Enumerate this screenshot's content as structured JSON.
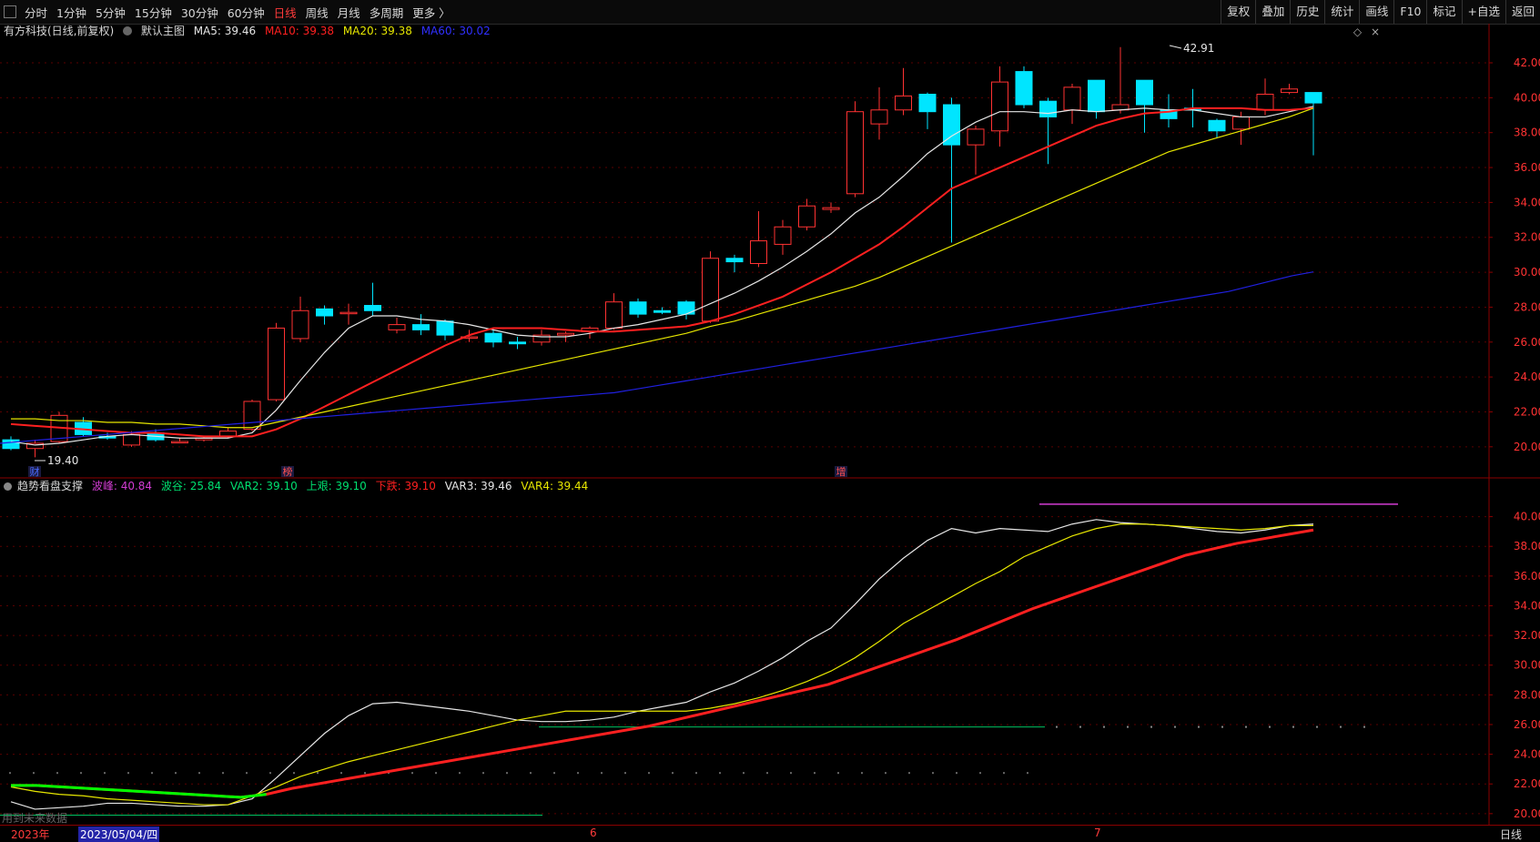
{
  "toolbar": {
    "periods": [
      "分时",
      "1分钟",
      "5分钟",
      "15分钟",
      "30分钟",
      "60分钟",
      "日线",
      "周线",
      "月线",
      "多周期",
      "更多 〉"
    ],
    "active_index": 6,
    "right": [
      "复权",
      "叠加",
      "历史",
      "统计",
      "画线",
      "F10",
      "标记",
      "+自选",
      "返回"
    ]
  },
  "main": {
    "title": "有方科技(日线,前复权)",
    "template": "默认主图",
    "ma5": "MA5: 39.46",
    "ma10": "MA10: 39.38",
    "ma20": "MA20: 39.38",
    "ma60": "MA60: 30.02",
    "high_label": "42.91",
    "low_label": "19.40",
    "marker1": "财",
    "marker2": "榜",
    "marker3": "增"
  },
  "sub": {
    "title": "趋势看盘支撑",
    "bofeng": "波峰: 40.84",
    "bogu": "波谷: 25.84",
    "var2": "VAR2: 39.10",
    "shangchuan": "上艰: 39.10",
    "xiadie": "下跌: 39.10",
    "var3": "VAR3: 39.46",
    "var4": "VAR4: 39.44",
    "note": "用到未来数据"
  },
  "dateaxis": {
    "year": "2023年",
    "cursor": "2023/05/04/四",
    "m6": "6",
    "m7": "7",
    "period": "日线"
  },
  "colors": {
    "up": "#ff3232",
    "down": "#00e5ff",
    "ma5": "#e6e6e6",
    "ma10": "#ff2020",
    "ma20": "#e6e600",
    "ma60": "#2020e0",
    "purple": "#d23cd2",
    "green": "#00ff00",
    "grid": "#5a0000"
  },
  "chart_data": [
    {
      "type": "candlestick",
      "title": "有方科技(日线,前复权)",
      "ylim": [
        19,
        43.2
      ],
      "yticks": [
        20,
        22,
        24,
        26,
        28,
        30,
        32,
        34,
        36,
        38,
        40,
        42
      ],
      "candles": [
        {
          "o": 20.4,
          "h": 20.6,
          "l": 19.8,
          "c": 19.9
        },
        {
          "o": 19.9,
          "h": 20.4,
          "l": 19.4,
          "c": 20.2
        },
        {
          "o": 20.3,
          "h": 22.0,
          "l": 20.2,
          "c": 21.8
        },
        {
          "o": 21.4,
          "h": 21.7,
          "l": 20.6,
          "c": 20.7
        },
        {
          "o": 20.6,
          "h": 20.8,
          "l": 20.4,
          "c": 20.5
        },
        {
          "o": 20.1,
          "h": 20.9,
          "l": 20.0,
          "c": 20.7
        },
        {
          "o": 20.8,
          "h": 21.0,
          "l": 20.3,
          "c": 20.4
        },
        {
          "o": 20.3,
          "h": 20.5,
          "l": 20.2,
          "c": 20.3
        },
        {
          "o": 20.4,
          "h": 20.6,
          "l": 20.3,
          "c": 20.5
        },
        {
          "o": 20.6,
          "h": 21.1,
          "l": 20.5,
          "c": 20.9
        },
        {
          "o": 21.0,
          "h": 22.7,
          "l": 20.9,
          "c": 22.6
        },
        {
          "o": 22.7,
          "h": 27.1,
          "l": 22.6,
          "c": 26.8
        },
        {
          "o": 26.2,
          "h": 28.6,
          "l": 26.0,
          "c": 27.8
        },
        {
          "o": 27.9,
          "h": 28.1,
          "l": 27.0,
          "c": 27.5
        },
        {
          "o": 27.7,
          "h": 28.2,
          "l": 27.0,
          "c": 27.7
        },
        {
          "o": 28.1,
          "h": 29.4,
          "l": 27.5,
          "c": 27.8
        },
        {
          "o": 26.7,
          "h": 27.4,
          "l": 26.5,
          "c": 27.0
        },
        {
          "o": 27.0,
          "h": 27.6,
          "l": 26.4,
          "c": 26.7
        },
        {
          "o": 27.2,
          "h": 27.3,
          "l": 26.1,
          "c": 26.4
        },
        {
          "o": 26.3,
          "h": 26.7,
          "l": 26.0,
          "c": 26.3
        },
        {
          "o": 26.5,
          "h": 26.7,
          "l": 25.7,
          "c": 26.0
        },
        {
          "o": 26.0,
          "h": 26.3,
          "l": 25.6,
          "c": 25.9
        },
        {
          "o": 26.0,
          "h": 26.7,
          "l": 25.8,
          "c": 26.4
        },
        {
          "o": 26.4,
          "h": 26.6,
          "l": 26.0,
          "c": 26.5
        },
        {
          "o": 26.6,
          "h": 26.9,
          "l": 26.2,
          "c": 26.8
        },
        {
          "o": 26.8,
          "h": 28.8,
          "l": 26.7,
          "c": 28.3
        },
        {
          "o": 28.3,
          "h": 28.5,
          "l": 27.4,
          "c": 27.6
        },
        {
          "o": 27.8,
          "h": 28.0,
          "l": 27.6,
          "c": 27.7
        },
        {
          "o": 28.3,
          "h": 28.4,
          "l": 27.3,
          "c": 27.6
        },
        {
          "o": 27.2,
          "h": 31.2,
          "l": 27.1,
          "c": 30.8
        },
        {
          "o": 30.8,
          "h": 31.0,
          "l": 30.0,
          "c": 30.6
        },
        {
          "o": 30.5,
          "h": 33.5,
          "l": 30.3,
          "c": 31.8
        },
        {
          "o": 31.6,
          "h": 33.0,
          "l": 31.0,
          "c": 32.6
        },
        {
          "o": 32.6,
          "h": 34.2,
          "l": 32.4,
          "c": 33.8
        },
        {
          "o": 33.6,
          "h": 34.0,
          "l": 33.4,
          "c": 33.7
        },
        {
          "o": 34.5,
          "h": 39.8,
          "l": 34.3,
          "c": 39.2
        },
        {
          "o": 38.5,
          "h": 40.6,
          "l": 37.6,
          "c": 39.3
        },
        {
          "o": 39.3,
          "h": 41.7,
          "l": 39.0,
          "c": 40.1
        },
        {
          "o": 40.2,
          "h": 40.3,
          "l": 38.2,
          "c": 39.2
        },
        {
          "o": 39.6,
          "h": 40.0,
          "l": 31.7,
          "c": 37.3
        },
        {
          "o": 37.3,
          "h": 38.4,
          "l": 35.6,
          "c": 38.2
        },
        {
          "o": 38.1,
          "h": 41.8,
          "l": 37.2,
          "c": 40.9
        },
        {
          "o": 41.5,
          "h": 41.8,
          "l": 39.4,
          "c": 39.6
        },
        {
          "o": 39.8,
          "h": 40.0,
          "l": 36.2,
          "c": 38.9
        },
        {
          "o": 39.3,
          "h": 40.8,
          "l": 38.5,
          "c": 40.6
        },
        {
          "o": 41.0,
          "h": 41.0,
          "l": 38.8,
          "c": 39.2
        },
        {
          "o": 39.3,
          "h": 42.9,
          "l": 39.1,
          "c": 39.6
        },
        {
          "o": 41.0,
          "h": 41.0,
          "l": 38.0,
          "c": 39.6
        },
        {
          "o": 39.3,
          "h": 40.2,
          "l": 38.3,
          "c": 38.8
        },
        {
          "o": 39.4,
          "h": 40.5,
          "l": 38.3,
          "c": 39.3
        },
        {
          "o": 38.7,
          "h": 38.8,
          "l": 37.7,
          "c": 38.1
        },
        {
          "o": 38.2,
          "h": 39.2,
          "l": 37.3,
          "c": 38.9
        },
        {
          "o": 39.3,
          "h": 41.1,
          "l": 39.0,
          "c": 40.2
        },
        {
          "o": 40.3,
          "h": 40.8,
          "l": 40.2,
          "c": 40.5
        },
        {
          "o": 40.3,
          "h": 40.3,
          "l": 36.7,
          "c": 39.7
        }
      ],
      "series": [
        {
          "name": "MA5",
          "values": [
            20.3,
            20.1,
            20.2,
            20.4,
            20.6,
            20.7,
            20.6,
            20.5,
            20.5,
            20.5,
            20.8,
            22.1,
            23.8,
            25.4,
            26.8,
            27.5,
            27.5,
            27.3,
            27.2,
            27.0,
            26.7,
            26.4,
            26.3,
            26.3,
            26.5,
            26.8,
            27.0,
            27.3,
            27.6,
            28.2,
            28.8,
            29.5,
            30.3,
            31.2,
            32.2,
            33.4,
            34.3,
            35.5,
            36.8,
            37.8,
            38.6,
            39.2,
            39.2,
            39.1,
            39.3,
            39.2,
            39.3,
            39.4,
            39.3,
            39.3,
            39.1,
            38.9,
            38.9,
            39.2,
            39.5
          ]
        },
        {
          "name": "MA10",
          "values": [
            21.3,
            21.2,
            21.1,
            21.0,
            20.9,
            20.8,
            20.8,
            20.7,
            20.6,
            20.6,
            20.6,
            21.0,
            21.6,
            22.3,
            23.0,
            23.7,
            24.4,
            25.1,
            25.8,
            26.4,
            26.8,
            26.8,
            26.8,
            26.7,
            26.6,
            26.6,
            26.7,
            26.8,
            26.9,
            27.2,
            27.6,
            28.1,
            28.6,
            29.3,
            30.0,
            30.8,
            31.6,
            32.6,
            33.7,
            34.8,
            35.4,
            36.0,
            36.6,
            37.2,
            37.8,
            38.4,
            38.8,
            39.1,
            39.2,
            39.4,
            39.4,
            39.4,
            39.3,
            39.3,
            39.4
          ]
        },
        {
          "name": "MA20",
          "values": [
            21.6,
            21.6,
            21.5,
            21.5,
            21.4,
            21.4,
            21.3,
            21.3,
            21.2,
            21.1,
            21.1,
            21.4,
            21.7,
            22.0,
            22.3,
            22.6,
            22.9,
            23.2,
            23.5,
            23.8,
            24.1,
            24.4,
            24.7,
            25.0,
            25.3,
            25.6,
            25.9,
            26.2,
            26.5,
            26.9,
            27.2,
            27.6,
            28.0,
            28.4,
            28.8,
            29.2,
            29.7,
            30.3,
            30.9,
            31.5,
            32.1,
            32.7,
            33.3,
            33.9,
            34.5,
            35.1,
            35.7,
            36.3,
            36.9,
            37.3,
            37.7,
            38.1,
            38.5,
            38.9,
            39.4
          ]
        },
        {
          "name": "MA60",
          "values": [
            20.2,
            20.3,
            20.4,
            20.5,
            20.6,
            20.7,
            20.8,
            20.9,
            21.0,
            21.1,
            21.2,
            21.3,
            21.4,
            21.5,
            21.6,
            21.7,
            21.8,
            21.9,
            22.0,
            22.1,
            22.2,
            22.3,
            22.4,
            22.5,
            22.6,
            22.7,
            22.8,
            22.9,
            23.0,
            23.1,
            23.3,
            23.5,
            23.7,
            23.9,
            24.1,
            24.3,
            24.5,
            24.7,
            24.9,
            25.1,
            25.3,
            25.5,
            25.7,
            25.9,
            26.1,
            26.3,
            26.5,
            26.7,
            26.9,
            27.1,
            27.3,
            27.5,
            27.7,
            27.9,
            28.1,
            28.3,
            28.5,
            28.7,
            28.9,
            29.2,
            29.5,
            29.8,
            30.02
          ]
        }
      ]
    },
    {
      "type": "line",
      "title": "趋势看盘支撑",
      "ylim": [
        19.5,
        41.2
      ],
      "yticks": [
        20,
        22,
        24,
        26,
        28,
        30,
        32,
        34,
        36,
        38,
        40
      ],
      "series": [
        {
          "name": "VAR3",
          "values": [
            20.8,
            20.3,
            20.4,
            20.5,
            20.7,
            20.7,
            20.6,
            20.5,
            20.5,
            20.6,
            21.0,
            22.4,
            23.9,
            25.4,
            26.6,
            27.4,
            27.5,
            27.3,
            27.1,
            26.9,
            26.6,
            26.3,
            26.2,
            26.2,
            26.3,
            26.5,
            26.9,
            27.2,
            27.5,
            28.2,
            28.8,
            29.6,
            30.5,
            31.6,
            32.5,
            34.1,
            35.8,
            37.2,
            38.4,
            39.2,
            38.9,
            39.2,
            39.1,
            39.0,
            39.5,
            39.8,
            39.6,
            39.5,
            39.4,
            39.2,
            39.0,
            38.9,
            39.1,
            39.4,
            39.5
          ]
        },
        {
          "name": "VAR4",
          "values": [
            21.8,
            21.5,
            21.3,
            21.2,
            21.0,
            20.9,
            20.8,
            20.7,
            20.6,
            20.6,
            21.2,
            21.8,
            22.5,
            23.0,
            23.5,
            23.9,
            24.3,
            24.7,
            25.1,
            25.5,
            25.9,
            26.3,
            26.6,
            26.9,
            26.9,
            26.9,
            26.9,
            26.9,
            26.9,
            27.1,
            27.4,
            27.8,
            28.3,
            28.9,
            29.6,
            30.5,
            31.6,
            32.8,
            33.7,
            34.6,
            35.5,
            36.3,
            37.3,
            38.0,
            38.7,
            39.2,
            39.5,
            39.5,
            39.4,
            39.3,
            39.2,
            39.1,
            39.2,
            39.4,
            39.4
          ]
        },
        {
          "name": "VAR2",
          "values": [
            21.9,
            21.9,
            21.8,
            21.7,
            21.6,
            21.5,
            21.4,
            21.3,
            21.2,
            21.1,
            21.3,
            21.7,
            22.0,
            22.3,
            22.6,
            22.9,
            23.2,
            23.5,
            23.8,
            24.1,
            24.4,
            24.7,
            25.0,
            25.3,
            25.6,
            25.9,
            26.3,
            26.7,
            27.1,
            27.5,
            27.9,
            28.3,
            28.7,
            29.3,
            29.9,
            30.5,
            31.1,
            31.7,
            32.4,
            33.1,
            33.8,
            34.4,
            35.0,
            35.6,
            36.2,
            36.8,
            37.4,
            37.8,
            38.2,
            38.5,
            38.8,
            39.1
          ]
        }
      ],
      "bofeng": 40.84,
      "bogu": 25.84
    }
  ]
}
